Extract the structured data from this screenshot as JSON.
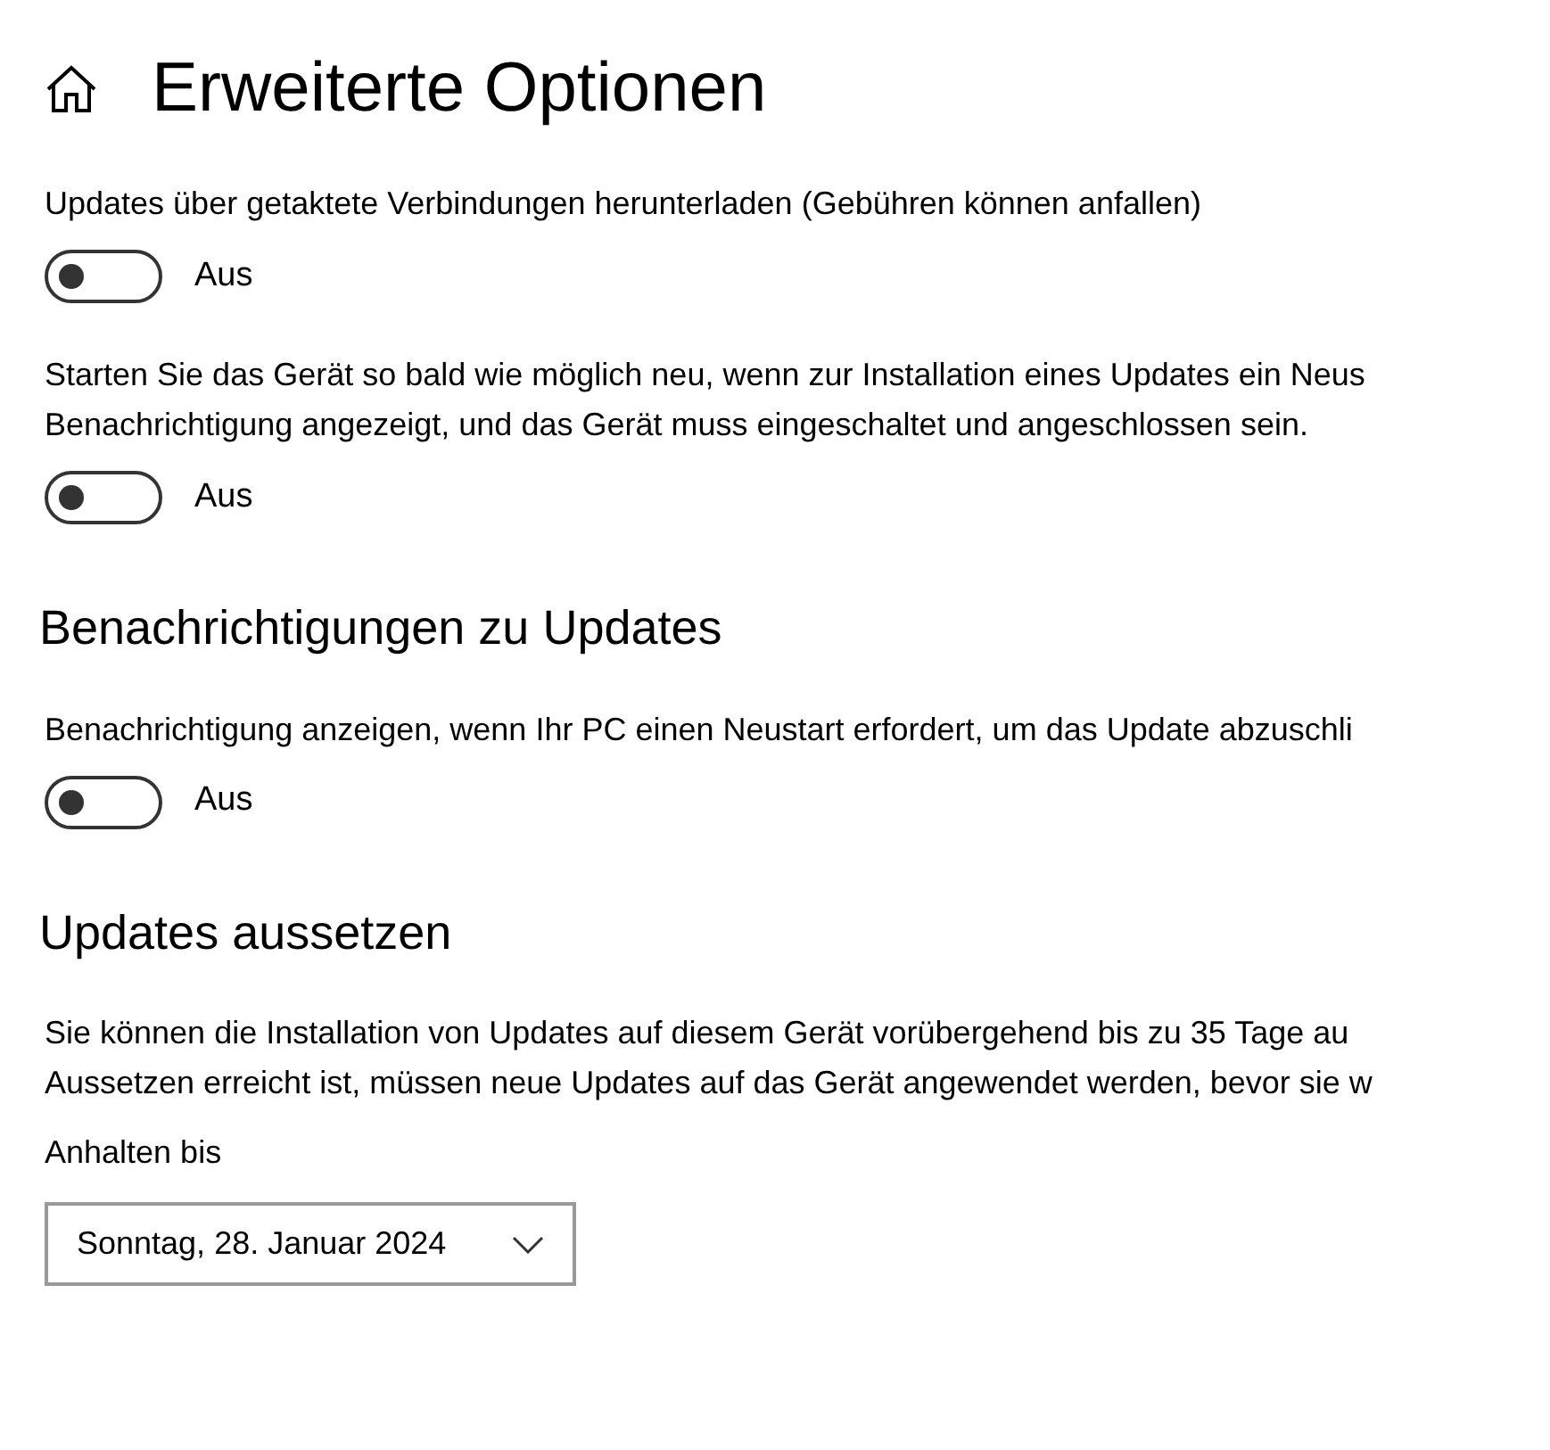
{
  "page": {
    "title": "Erweiterte Optionen"
  },
  "sections": [
    {
      "settings": [
        {
          "text": "Updates über getaktete Verbindungen herunterladen (Gebühren können anfallen)",
          "toggle": {
            "on": false,
            "label": "Aus"
          }
        },
        {
          "text": "Starten Sie das Gerät so bald wie möglich neu, wenn zur Installation eines Updates ein Neus\nBenachrichtigung angezeigt, und das Gerät muss eingeschaltet und angeschlossen sein.",
          "toggle": {
            "on": false,
            "label": "Aus"
          }
        }
      ]
    },
    {
      "heading": "Benachrichtigungen zu Updates",
      "settings": [
        {
          "text": "Benachrichtigung anzeigen, wenn Ihr PC einen Neustart erfordert, um das Update abzuschli",
          "toggle": {
            "on": false,
            "label": "Aus"
          }
        }
      ]
    },
    {
      "heading": "Updates aussetzen",
      "description": "Sie können die Installation von Updates auf diesem Gerät vorübergehend bis zu 35 Tage au\nAussetzen erreicht ist, müssen neue Updates auf das Gerät angewendet werden, bevor sie w",
      "dropdown": {
        "label": "Anhalten bis",
        "value": "Sonntag, 28. Januar 2024"
      }
    }
  ]
}
